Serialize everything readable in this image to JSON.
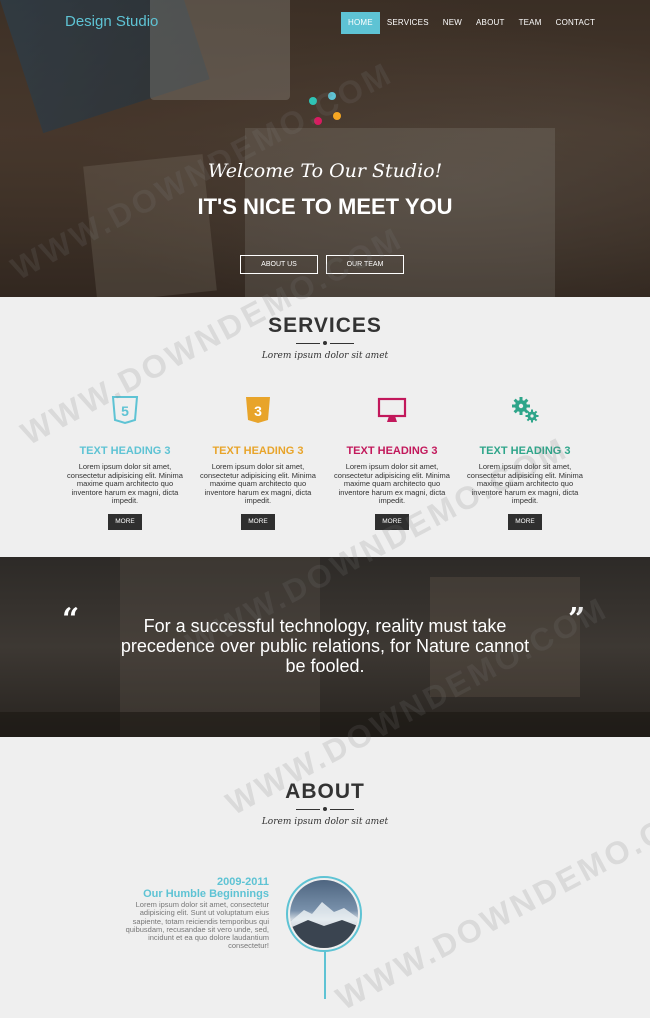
{
  "header": {
    "brand": "Design Studio",
    "nav": [
      "HOME",
      "SERVICES",
      "NEW",
      "ABOUT",
      "TEAM",
      "CONTACT"
    ],
    "active_nav": "HOME"
  },
  "hero": {
    "welcome": "Welcome To Our Studio!",
    "tagline": "IT'S NICE TO MEET YOU",
    "buttons": [
      "ABOUT US",
      "OUR TEAM"
    ],
    "dot_colors": [
      "#2ec4b6",
      "#5ec3d4",
      "#d81b60",
      "#f5a623"
    ]
  },
  "services": {
    "title": "SERVICES",
    "subtitle": "Lorem ipsum dolor sit amet",
    "items": [
      {
        "icon": "html5-icon",
        "heading": "TEXT HEADING 3",
        "color": "#5ec3d4",
        "text": "Lorem ipsum dolor sit amet, consectetur adipisicing elit. Minima maxime quam architecto quo inventore harum ex magni, dicta impedit.",
        "button": "MORE"
      },
      {
        "icon": "css3-icon",
        "heading": "TEXT HEADING 3",
        "color": "#e8a42a",
        "text": "Lorem ipsum dolor sit amet, consectetur adipisicing elit. Minima maxime quam architecto quo inventore harum ex magni, dicta impedit.",
        "button": "MORE"
      },
      {
        "icon": "monitor-icon",
        "heading": "TEXT HEADING 3",
        "color": "#c2185b",
        "text": "Lorem ipsum dolor sit amet, consectetur adipisicing elit. Minima maxime quam architecto quo inventore harum ex magni, dicta impedit.",
        "button": "MORE"
      },
      {
        "icon": "gears-icon",
        "heading": "TEXT HEADING 3",
        "color": "#2ea58a",
        "text": "Lorem ipsum dolor sit amet, consectetur adipisicing elit. Minima maxime quam architecto quo inventore harum ex magni, dicta impedit.",
        "button": "MORE"
      }
    ]
  },
  "quote": {
    "open_mark": "“",
    "close_mark": "”",
    "text": "For a successful technology, reality must take precedence over public relations, for Nature cannot be fooled."
  },
  "about": {
    "title": "ABOUT",
    "subtitle": "Lorem ipsum dolor sit amet",
    "timeline": [
      {
        "years": "2009-2011",
        "heading": "Our Humble Beginnings",
        "text": "Lorem ipsum dolor sit amet, consectetur adipisicing elit. Sunt ut voluptatum eius sapiente, totam reiciendis temporibus qui quibusdam, recusandae sit vero unde, sed, incidunt et ea quo dolore laudantium consectetur!"
      }
    ]
  },
  "watermark": "WWW.DOWNDEMO.COM",
  "theme": {
    "accent": "#5ec3d4",
    "dark_button": "#2f2f2f"
  }
}
